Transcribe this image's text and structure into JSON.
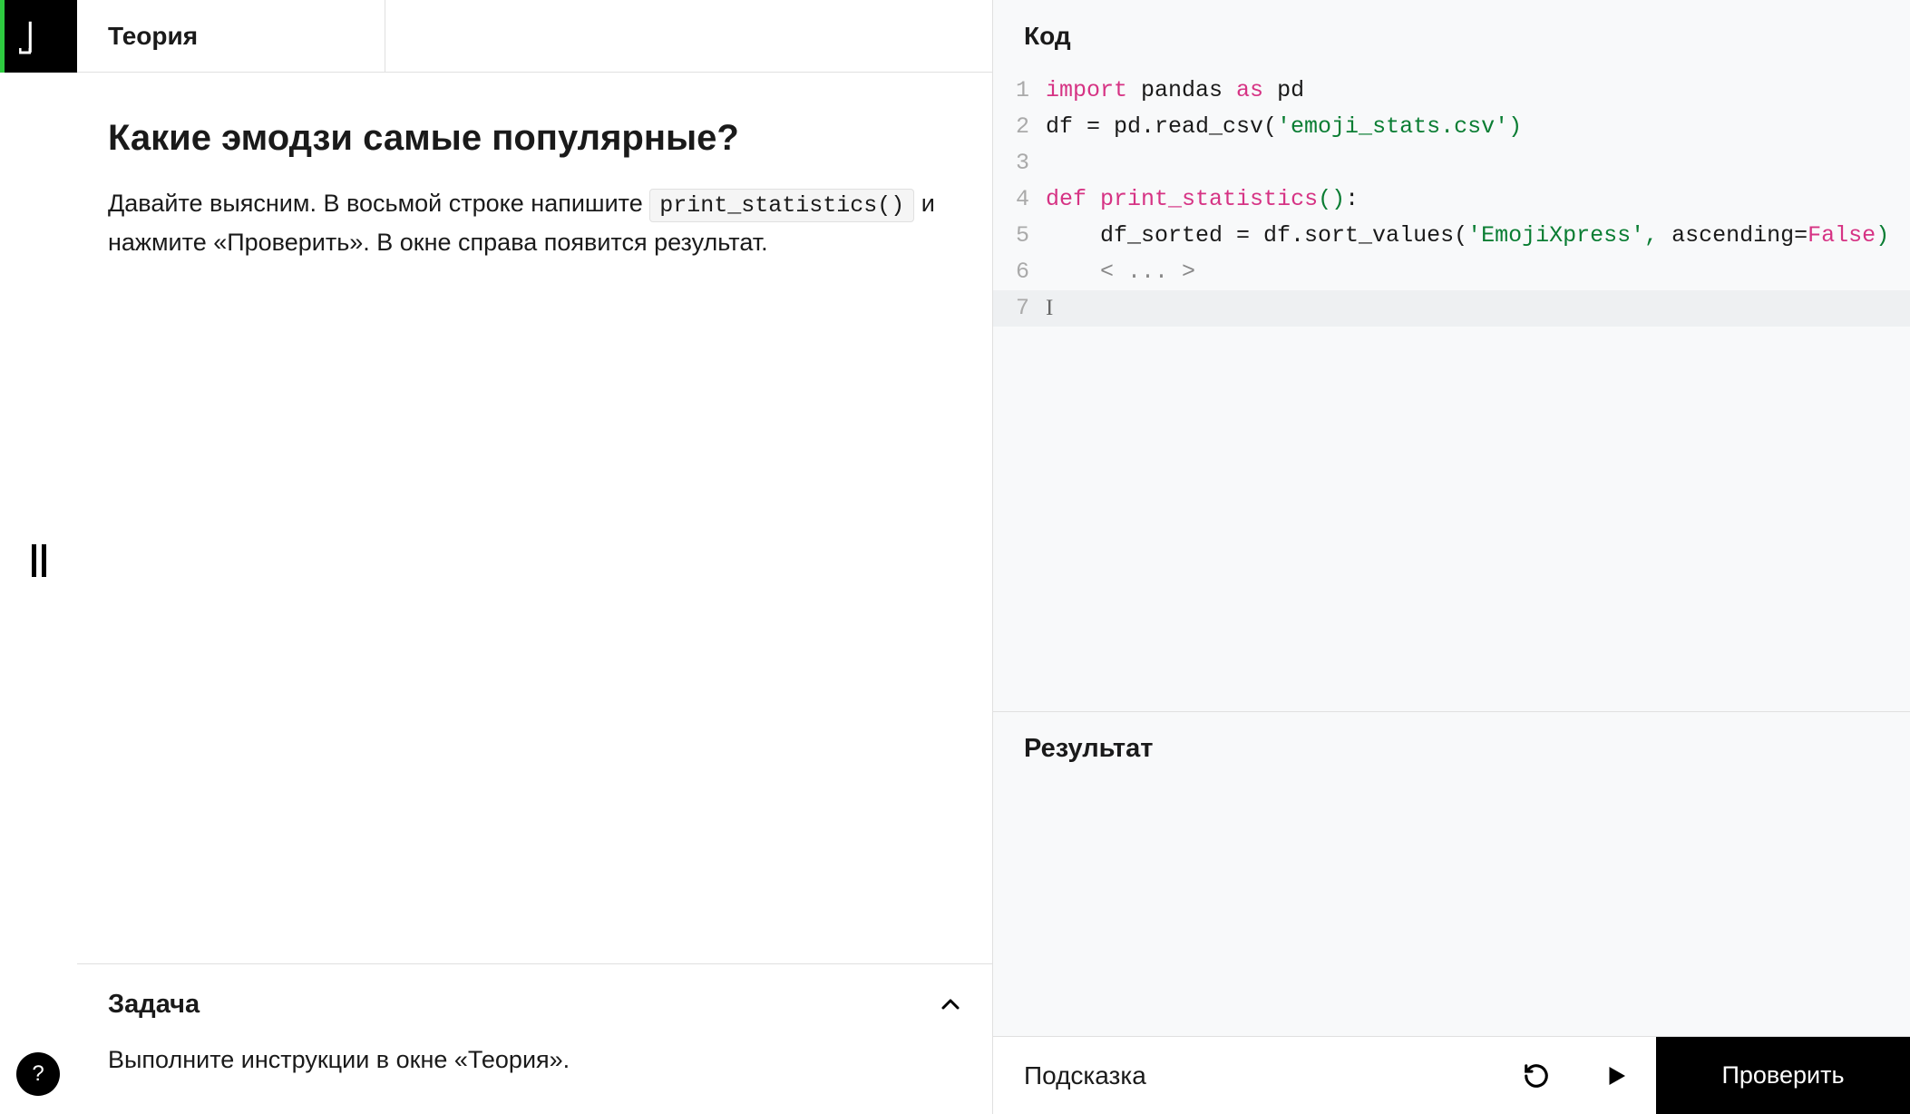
{
  "sidebar": {
    "logo_text": "⎡⎤",
    "help_label": "?"
  },
  "tabs": {
    "theory_label": "Теория"
  },
  "theory": {
    "title": "Какие эмодзи самые популярные?",
    "text_before_code": "Давайте выясним. В восьмой строке напишите ",
    "inline_code": "print_statistics()",
    "text_after_code": " и нажмите «Проверить». В окне справа появится результат."
  },
  "task": {
    "title": "Задача",
    "body": "Выполните инструкции в окне «Теория»."
  },
  "code": {
    "header": "Код",
    "lines": [
      {
        "n": "1",
        "tokens": [
          [
            "kw-import",
            "import"
          ],
          [
            "",
            " pandas "
          ],
          [
            "kw-import",
            "as"
          ],
          [
            "",
            " pd"
          ]
        ]
      },
      {
        "n": "2",
        "tokens": [
          [
            "",
            "df = pd.read_csv("
          ],
          [
            "str",
            "'emoji_stats.csv'"
          ],
          [
            "punc",
            ")"
          ]
        ]
      },
      {
        "n": "3",
        "tokens": [
          [
            "",
            ""
          ]
        ]
      },
      {
        "n": "4",
        "tokens": [
          [
            "kw-def",
            "def"
          ],
          [
            "",
            " "
          ],
          [
            "fn",
            "print_statistics"
          ],
          [
            "punc",
            "()"
          ],
          [
            "",
            ":"
          ]
        ]
      },
      {
        "n": "5",
        "tokens": [
          [
            "",
            "    df_sorted = df.sort_values("
          ],
          [
            "str",
            "'EmojiXpress'"
          ],
          [
            "punc",
            ","
          ],
          [
            "",
            " ascending="
          ],
          [
            "kw-false",
            "False"
          ],
          [
            "punc",
            ")"
          ]
        ]
      },
      {
        "n": "6",
        "tokens": [
          [
            "",
            "    "
          ],
          [
            "comment",
            "< ... >"
          ]
        ]
      },
      {
        "n": "7",
        "tokens": [
          [
            "",
            ""
          ]
        ],
        "active": true,
        "cursor": true
      }
    ]
  },
  "result": {
    "header": "Результат"
  },
  "bottombar": {
    "hint": "Подсказка",
    "check": "Проверить"
  }
}
